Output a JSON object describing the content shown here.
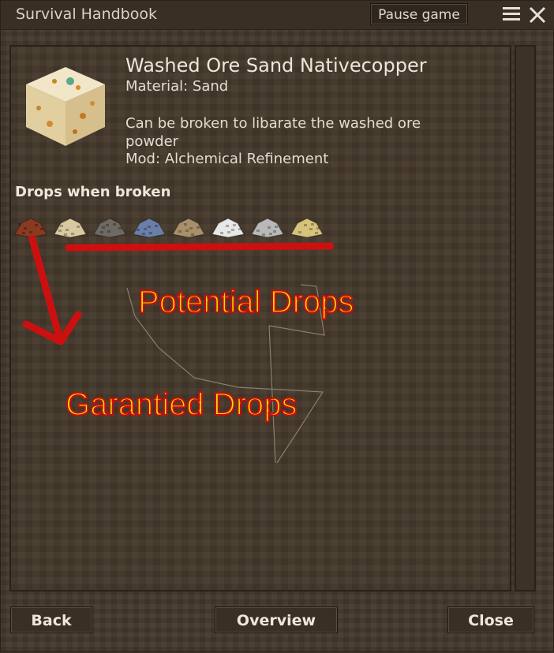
{
  "window": {
    "title": "Survival Handbook",
    "pause_label": "Pause game",
    "menu_icon": "hamburger-menu-icon",
    "close_icon": "close-x-icon"
  },
  "item": {
    "name": "Washed Ore Sand Nativecopper",
    "material": "Material: Sand",
    "description": "Can be broken to libarate the washed ore powder",
    "mod": "Mod: Alchemical Refinement",
    "icon": "washed-ore-sand-block-icon"
  },
  "drops": {
    "heading": "Drops when broken",
    "items": [
      {
        "icon": "copper-ore-drop-icon",
        "color": "#8a3a20"
      },
      {
        "icon": "sand-pile-drop-icon",
        "color": "#d8c9a0"
      },
      {
        "icon": "dark-gravel-drop-icon",
        "color": "#6e6a62"
      },
      {
        "icon": "blue-ore-drop-icon",
        "color": "#6a7fa8"
      },
      {
        "icon": "brown-sand-drop-icon",
        "color": "#a8906a"
      },
      {
        "icon": "red-white-powder-drop-icon",
        "color": "#e8e8e8"
      },
      {
        "icon": "grey-gravel-drop-icon",
        "color": "#b8b8b8"
      },
      {
        "icon": "yellow-sand-drop-icon",
        "color": "#d6c27a"
      }
    ]
  },
  "annotations": {
    "potential": "Potential Drops",
    "garantied": "Garantied Drops",
    "text_color": "#f2e200",
    "stroke_color": "#c01010"
  },
  "footer": {
    "back": "Back",
    "overview": "Overview",
    "close": "Close"
  }
}
